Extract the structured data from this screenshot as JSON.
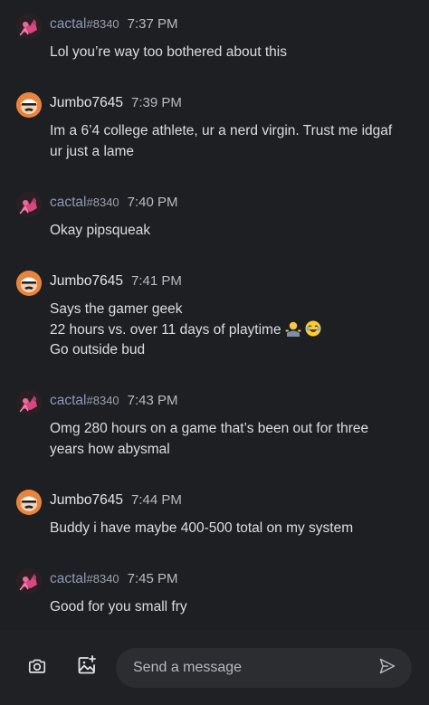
{
  "messages": [
    {
      "user": "cactal",
      "discriminator": "#8340",
      "time": "7:37 PM",
      "avatar": "cactal-avatar",
      "lines": [
        "Lol you’re way too bothered about this"
      ]
    },
    {
      "user": "Jumbo7645",
      "time": "7:39 PM",
      "avatar": "jumbo-avatar",
      "lines": [
        "Im a 6’4 college athlete, ur a nerd virgin. Trust me idgaf",
        "ur just a lame"
      ]
    },
    {
      "user": "cactal",
      "discriminator": "#8340",
      "time": "7:40 PM",
      "avatar": "cactal-avatar",
      "lines": [
        "Okay pipsqueak"
      ]
    },
    {
      "user": "Jumbo7645",
      "time": "7:41 PM",
      "avatar": "jumbo-avatar",
      "lines": [
        "Says the gamer geek",
        "22 hours vs. over 11 days of playtime",
        "Go outside bud"
      ],
      "emojis": [
        "man-shrugging-emoji",
        "joy-emoji"
      ]
    },
    {
      "user": "cactal",
      "discriminator": "#8340",
      "time": "7:43 PM",
      "avatar": "cactal-avatar",
      "lines": [
        "Omg 280 hours on a game that’s been out for three",
        "years how abysmal"
      ]
    },
    {
      "user": "Jumbo7645",
      "time": "7:44 PM",
      "avatar": "jumbo-avatar",
      "lines": [
        "Buddy i have maybe 400-500 total on my system"
      ]
    },
    {
      "user": "cactal",
      "discriminator": "#8340",
      "time": "7:45 PM",
      "avatar": "cactal-avatar",
      "lines": [
        "Good for you small fry"
      ]
    }
  ],
  "composer": {
    "placeholder": "Send a message",
    "camera_icon": "camera-icon",
    "image_icon": "add-image-icon",
    "send_icon": "send-icon"
  },
  "colors": {
    "background": "#1e1f22",
    "composer_bar": "#202124",
    "input_background": "#2b2d31",
    "jumbo_avatar": "#e9843d",
    "cactal_avatar": "#d8477f",
    "cactal_name": "#8d98b4"
  }
}
